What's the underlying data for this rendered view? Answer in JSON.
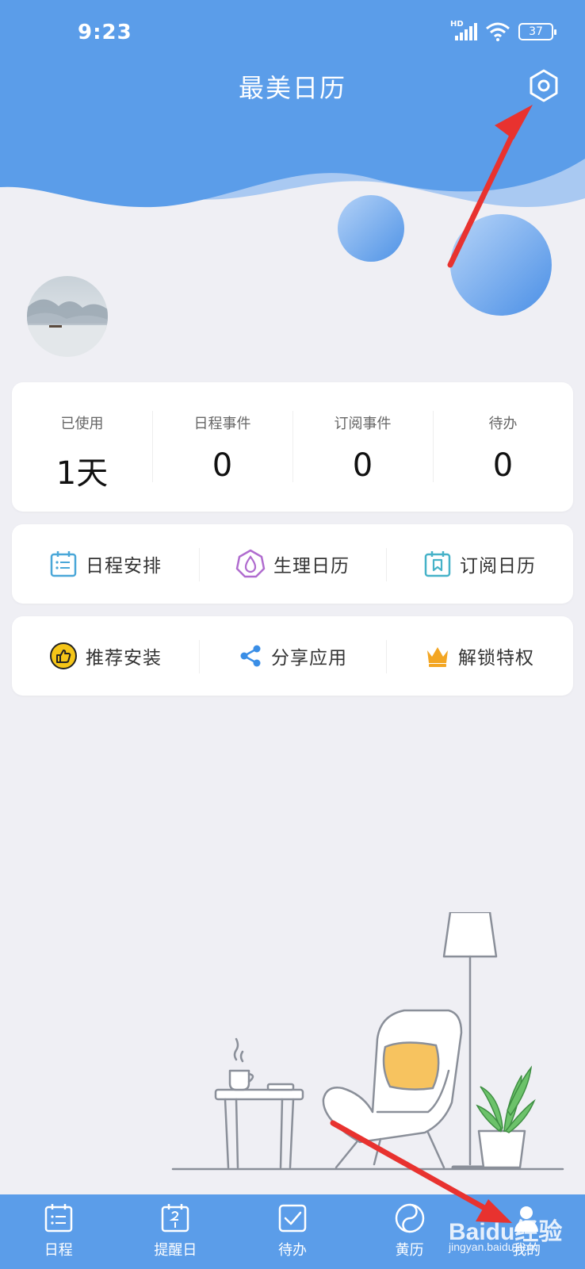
{
  "status_bar": {
    "time": "9:23",
    "battery": "37",
    "network_label": "HD"
  },
  "header": {
    "title": "最美日历"
  },
  "stats": [
    {
      "label": "已使用",
      "value": "1天"
    },
    {
      "label": "日程事件",
      "value": "0"
    },
    {
      "label": "订阅事件",
      "value": "0"
    },
    {
      "label": "待办",
      "value": "0"
    }
  ],
  "menu_row1": [
    {
      "label": "日程安排",
      "icon": "schedule-icon",
      "color": "#4aa7d8"
    },
    {
      "label": "生理日历",
      "icon": "drop-icon",
      "color": "#b06ccf"
    },
    {
      "label": "订阅日历",
      "icon": "bookmark-calendar-icon",
      "color": "#46b2c8"
    }
  ],
  "menu_row2": [
    {
      "label": "推荐安装",
      "icon": "thumbs-up-icon",
      "color": "#f5c518"
    },
    {
      "label": "分享应用",
      "icon": "share-icon",
      "color": "#3a8ee6"
    },
    {
      "label": "解锁特权",
      "icon": "crown-icon",
      "color": "#f3a623"
    }
  ],
  "tabs": [
    {
      "label": "日程",
      "icon": "calendar-list-icon"
    },
    {
      "label": "提醒日",
      "icon": "calendar-reminder-icon"
    },
    {
      "label": "待办",
      "icon": "checkbox-icon"
    },
    {
      "label": "黄历",
      "icon": "yin-yang-icon"
    },
    {
      "label": "我的",
      "icon": "profile-icon"
    }
  ],
  "watermark": {
    "brand": "Baidu经验",
    "url": "jingyan.baidu.com"
  },
  "colors": {
    "primary": "#5b9de9",
    "background": "#efeff4",
    "annotation_arrow": "#e8322f"
  }
}
